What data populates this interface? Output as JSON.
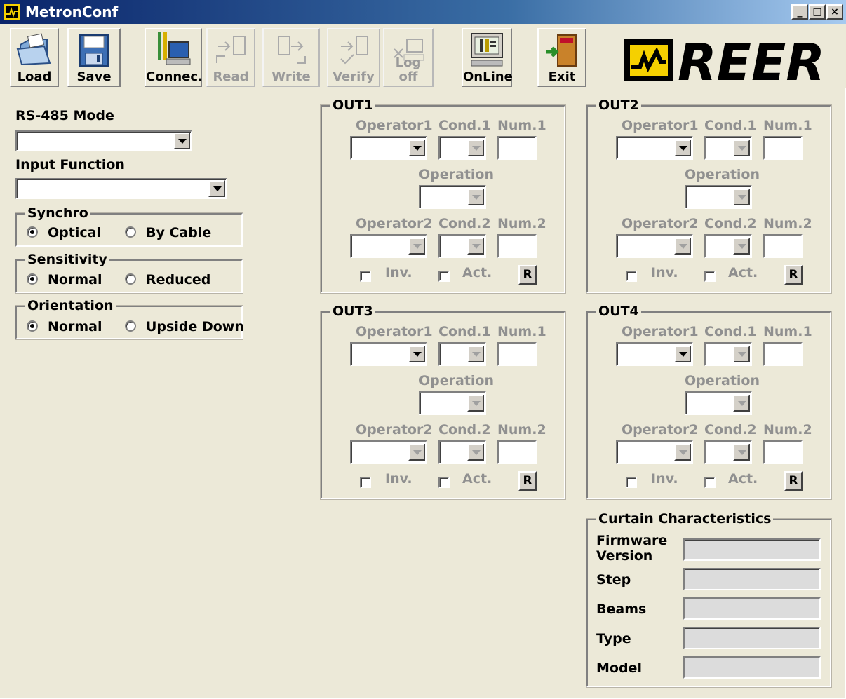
{
  "window": {
    "title": "MetronConf",
    "controls": {
      "minimize": "_",
      "maximize": "□",
      "close": "×"
    }
  },
  "toolbar": {
    "buttons": [
      {
        "label": "Load",
        "icon": "folder-open-icon",
        "enabled": true
      },
      {
        "label": "Save",
        "icon": "floppy-disk-icon",
        "enabled": true
      },
      {
        "label": "Connec.",
        "icon": "computer-connect-icon",
        "enabled": true
      },
      {
        "label": "Read",
        "icon": "read-device-icon",
        "enabled": false
      },
      {
        "label": "Write",
        "icon": "write-device-icon",
        "enabled": false
      },
      {
        "label": "Verify",
        "icon": "verify-device-icon",
        "enabled": false
      },
      {
        "label": "Log off",
        "icon": "log-off-icon",
        "enabled": false
      },
      {
        "label": "OnLine",
        "icon": "monitor-online-icon",
        "enabled": true
      },
      {
        "label": "Exit",
        "icon": "exit-door-icon",
        "enabled": true
      }
    ],
    "logo_text": "REER"
  },
  "left": {
    "rs485_label": "RS-485 Mode",
    "rs485_value": "",
    "input_function_label": "Input Function",
    "input_function_value": "",
    "synchro": {
      "title": "Synchro",
      "opt1": "Optical",
      "opt2": "By Cable",
      "selected": "Optical"
    },
    "sensitivity": {
      "title": "Sensitivity",
      "opt1": "Normal",
      "opt2": "Reduced",
      "selected": "Normal"
    },
    "orientation": {
      "title": "Orientation",
      "opt1": "Normal",
      "opt2": "Upside Down",
      "selected": "Normal"
    }
  },
  "outputs": [
    {
      "title": "OUT1"
    },
    {
      "title": "OUT2"
    },
    {
      "title": "OUT3"
    },
    {
      "title": "OUT4"
    }
  ],
  "out_labels": {
    "operator1": "Operator1",
    "cond1": "Cond.1",
    "num1": "Num.1",
    "operation": "Operation",
    "operator2": "Operator2",
    "cond2": "Cond.2",
    "num2": "Num.2",
    "inv": "Inv.",
    "act": "Act.",
    "reset": "R"
  },
  "curtain": {
    "title": "Curtain Characteristics",
    "firmware_label_1": "Firmware",
    "firmware_label_2": "Version",
    "step_label": "Step",
    "beams_label": "Beams",
    "type_label": "Type",
    "model_label": "Model"
  },
  "colors": {
    "face": "#ece9d8",
    "title_start": "#0a246a",
    "disabled_text": "#909090",
    "logo_yellow": "#f5d000"
  }
}
